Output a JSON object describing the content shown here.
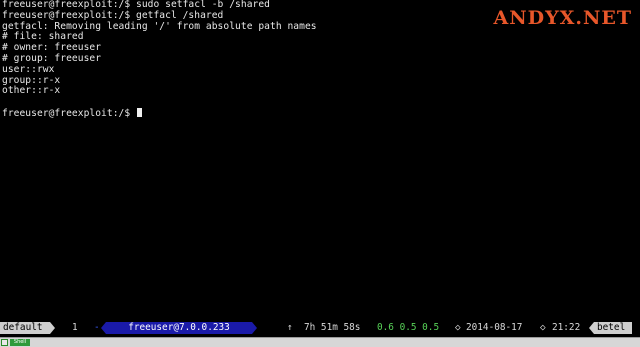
{
  "terminal": {
    "lines": [
      "freeuser@freexploit:/$ sudo setfacl -b /shared",
      "freeuser@freexploit:/$ getfacl /shared",
      "getfacl: Removing leading '/' from absolute path names",
      "# file: shared",
      "# owner: freeuser",
      "# group: freeuser",
      "user::rwx",
      "group::r-x",
      "other::r-x",
      "",
      "freeuser@freexploit:/$ "
    ]
  },
  "watermark": {
    "text": "ANDYX.NET",
    "colors": {
      "main": "#e8572a",
      "accent": "#f2c12e"
    }
  },
  "status_bar": {
    "session": "default",
    "window_number": "1",
    "window_marker": "-",
    "host": "freeuser@7.0.0.233",
    "uptime_icon": "up-arrow-icon",
    "uptime": "7h 51m 58s",
    "load": "0.6 0.5 0.5",
    "date_icon": "diamond-icon",
    "date": "2014-08-17",
    "time_icon": "diamond-icon",
    "time": "21:22",
    "hostname": "betel",
    "colors": {
      "host_bg": "#1a1aa8",
      "load": "#57d157",
      "tag_bg": "#cfcfcf"
    }
  },
  "dock": {
    "task_label": "Shell"
  }
}
